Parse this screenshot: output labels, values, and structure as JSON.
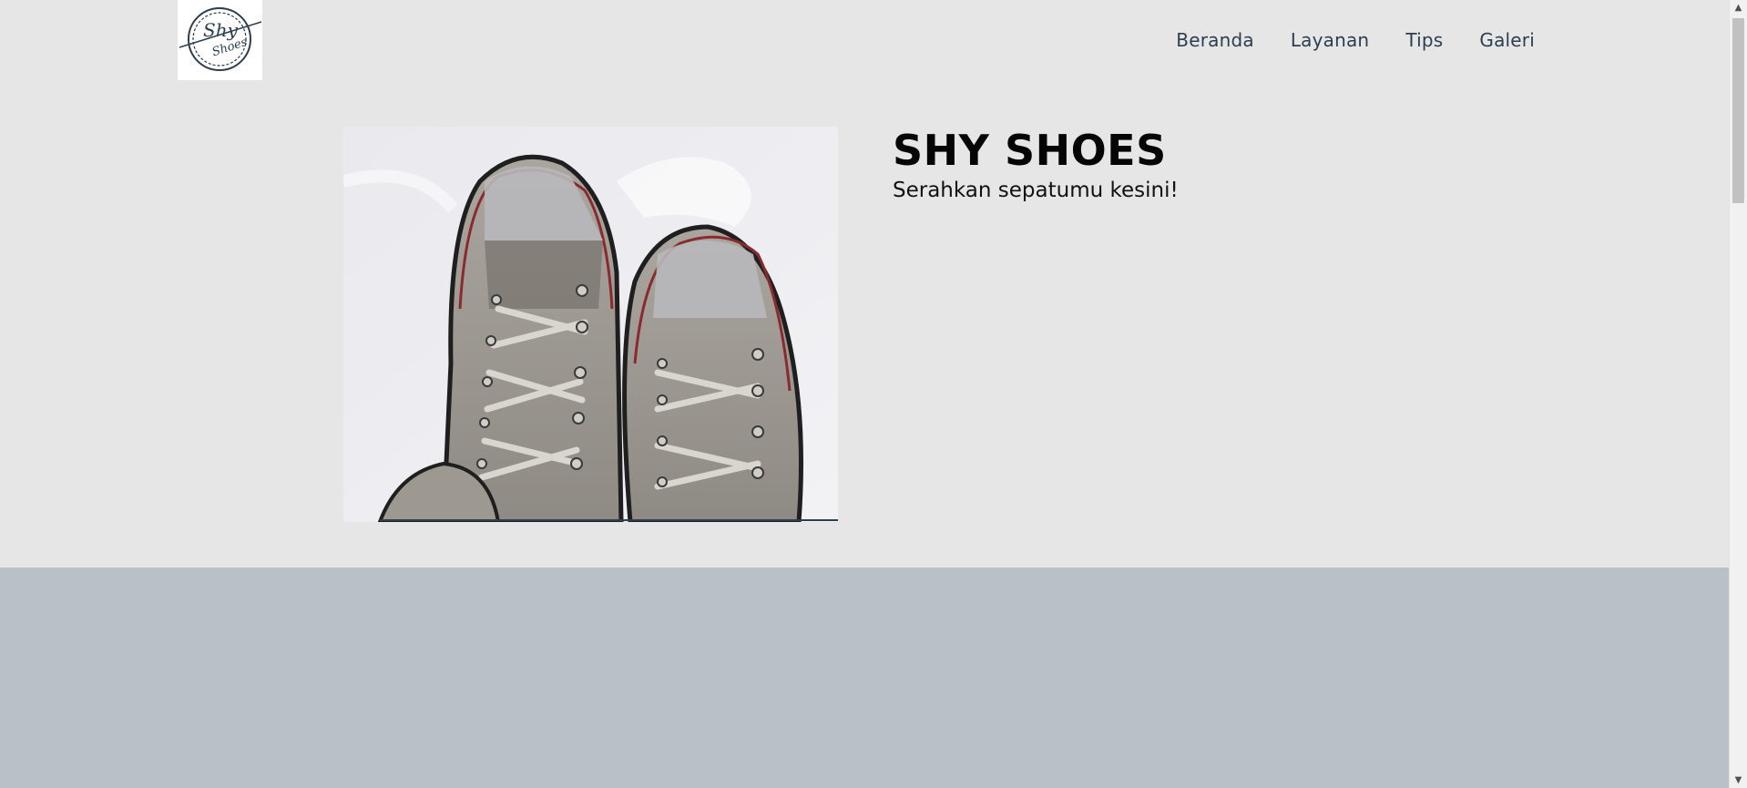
{
  "brand": {
    "logo_text": "Shy Shoes",
    "logo_color": "#2c3e50"
  },
  "nav": {
    "items": [
      {
        "label": "Beranda"
      },
      {
        "label": "Layanan"
      },
      {
        "label": "Tips"
      },
      {
        "label": "Galeri"
      }
    ],
    "color": "#2c3e50"
  },
  "hero": {
    "title": "SHY SHOES",
    "subtitle": "Serahkan sepatumu kesini!",
    "image_icon": "sneakers-photo"
  },
  "colors": {
    "page_bg": "#e6e6e6",
    "lower_section_bg": "#b9c0c8"
  },
  "scrollbar": {
    "up_icon": "▲",
    "down_icon": "▼"
  }
}
